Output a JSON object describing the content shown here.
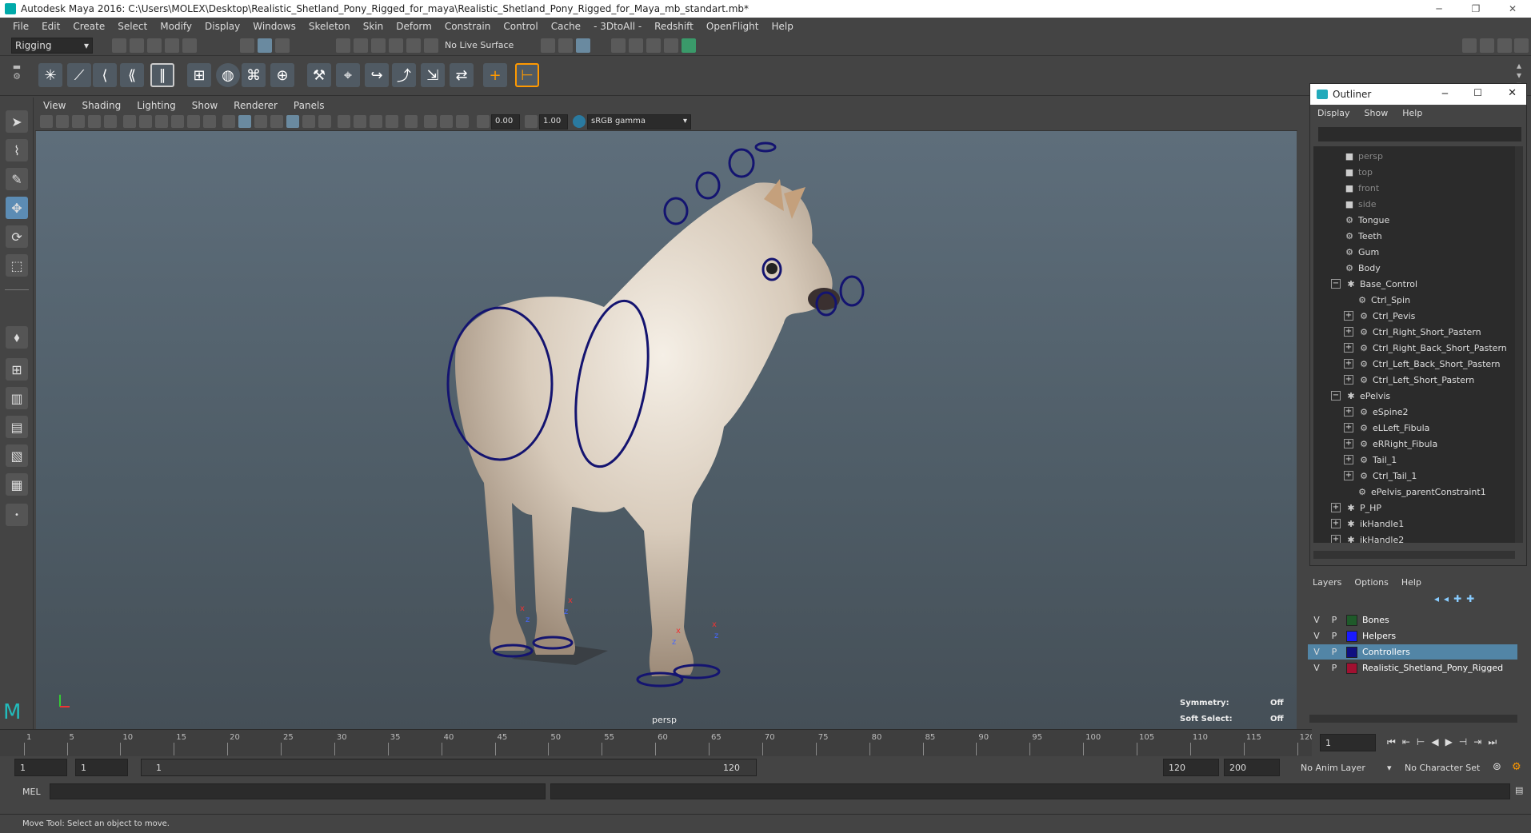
{
  "window": {
    "title": "Autodesk Maya 2016: C:\\Users\\MOLEX\\Desktop\\Realistic_Shetland_Pony_Rigged_for_maya\\Realistic_Shetland_Pony_Rigged_for_Maya_mb_standart.mb*"
  },
  "menubar": [
    "File",
    "Edit",
    "Create",
    "Select",
    "Modify",
    "Display",
    "Windows",
    "Skeleton",
    "Skin",
    "Deform",
    "Constrain",
    "Control",
    "Cache",
    "- 3DtoAll -",
    "Redshift",
    "OpenFlight",
    "Help"
  ],
  "statusline": {
    "mode": "Rigging",
    "live_surface": "No Live Surface"
  },
  "panel": {
    "menus": [
      "View",
      "Shading",
      "Lighting",
      "Show",
      "Renderer",
      "Panels"
    ],
    "exposure": "0.00",
    "gamma": "1.00",
    "color_space": "sRGB gamma"
  },
  "viewport": {
    "camera": "persp",
    "symmetry_label": "Symmetry:",
    "symmetry_value": "Off",
    "soft_select_label": "Soft Select:",
    "soft_select_value": "Off"
  },
  "timeline": {
    "ticks": [
      "1",
      "5",
      "10",
      "15",
      "20",
      "25",
      "30",
      "35",
      "40",
      "45",
      "50",
      "55",
      "60",
      "65",
      "70",
      "75",
      "80",
      "85",
      "90",
      "95",
      "100",
      "105",
      "110",
      "115",
      "120"
    ],
    "current_frame": "1"
  },
  "range": {
    "start": "1",
    "playback_start": "1",
    "slider_start": "1",
    "slider_end": "120",
    "playback_end": "120",
    "end": "200",
    "anim_layer": "No Anim Layer",
    "character_set": "No Character Set"
  },
  "cmdline": {
    "label": "MEL"
  },
  "helpline": {
    "text": "Move Tool: Select an object to move."
  },
  "outliner": {
    "title": "Outliner",
    "menus": [
      "Display",
      "Show",
      "Help"
    ],
    "items": [
      {
        "label": "persp",
        "indent": 2,
        "dim": true,
        "exp": ""
      },
      {
        "label": "top",
        "indent": 2,
        "dim": true,
        "exp": ""
      },
      {
        "label": "front",
        "indent": 2,
        "dim": true,
        "exp": ""
      },
      {
        "label": "side",
        "indent": 2,
        "dim": true,
        "exp": ""
      },
      {
        "label": "Tongue",
        "indent": 2,
        "dim": false,
        "exp": ""
      },
      {
        "label": "Teeth",
        "indent": 2,
        "dim": false,
        "exp": ""
      },
      {
        "label": "Gum",
        "indent": 2,
        "dim": false,
        "exp": ""
      },
      {
        "label": "Body",
        "indent": 2,
        "dim": false,
        "exp": ""
      },
      {
        "label": "Base_Control",
        "indent": 1,
        "dim": false,
        "exp": "−"
      },
      {
        "label": "Ctrl_Spin",
        "indent": 3,
        "dim": false,
        "exp": ""
      },
      {
        "label": "Ctrl_Pevis",
        "indent": 2,
        "dim": false,
        "exp": "+"
      },
      {
        "label": "Ctrl_Right_Short_Pastern",
        "indent": 2,
        "dim": false,
        "exp": "+"
      },
      {
        "label": "Ctrl_Right_Back_Short_Pastern",
        "indent": 2,
        "dim": false,
        "exp": "+"
      },
      {
        "label": "Ctrl_Left_Back_Short_Pastern",
        "indent": 2,
        "dim": false,
        "exp": "+"
      },
      {
        "label": "Ctrl_Left_Short_Pastern",
        "indent": 2,
        "dim": false,
        "exp": "+"
      },
      {
        "label": "ePelvis",
        "indent": 1,
        "dim": false,
        "exp": "−"
      },
      {
        "label": "eSpine2",
        "indent": 2,
        "dim": false,
        "exp": "+"
      },
      {
        "label": "eLLeft_Fibula",
        "indent": 2,
        "dim": false,
        "exp": "+"
      },
      {
        "label": "eRRight_Fibula",
        "indent": 2,
        "dim": false,
        "exp": "+"
      },
      {
        "label": "Tail_1",
        "indent": 2,
        "dim": false,
        "exp": "+"
      },
      {
        "label": "Ctrl_Tail_1",
        "indent": 2,
        "dim": false,
        "exp": "+"
      },
      {
        "label": "ePelvis_parentConstraint1",
        "indent": 3,
        "dim": false,
        "exp": ""
      },
      {
        "label": "P_HP",
        "indent": 1,
        "dim": false,
        "exp": "+"
      },
      {
        "label": "ikHandle1",
        "indent": 1,
        "dim": false,
        "exp": "+"
      },
      {
        "label": "ikHandle2",
        "indent": 1,
        "dim": false,
        "exp": "+"
      }
    ]
  },
  "layers": {
    "menus": [
      "Layers",
      "Options",
      "Help"
    ],
    "rows": [
      {
        "v": "V",
        "p": "P",
        "name": "Bones",
        "color": "#1f5a2a",
        "selected": false
      },
      {
        "v": "V",
        "p": "P",
        "name": "Helpers",
        "color": "#1a1aff",
        "selected": false
      },
      {
        "v": "V",
        "p": "P",
        "name": "Controllers",
        "color": "#101080",
        "selected": true
      },
      {
        "v": "V",
        "p": "P",
        "name": "Realistic_Shetland_Pony_Rigged",
        "color": "#a01030",
        "selected": false
      }
    ]
  },
  "colors": {
    "accent": "#5285a6",
    "controller": "#141470"
  }
}
